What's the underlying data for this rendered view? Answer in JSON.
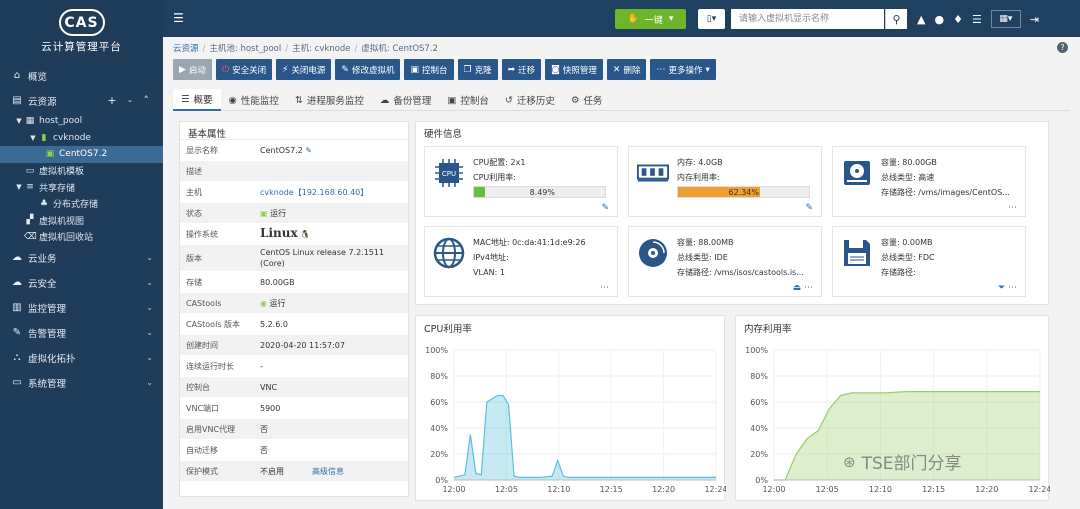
{
  "app": {
    "logo": "CAS",
    "title": "云计算管理平台"
  },
  "sidebar": {
    "items": [
      {
        "icon": "home-icon",
        "label": "概览"
      },
      {
        "icon": "cloud-resource-icon",
        "label": "云资源",
        "tools": "+ - ^"
      }
    ],
    "tree": [
      {
        "label": "host_pool",
        "toggle": "▾"
      },
      {
        "label": "cvknode",
        "toggle": "▾"
      },
      {
        "label": "CentOS7.2",
        "toggle": ""
      },
      {
        "label": "虚拟机模板",
        "toggle": ""
      },
      {
        "label": "共享存储",
        "toggle": "▾"
      },
      {
        "label": "分布式存储",
        "toggle": ""
      },
      {
        "label": "虚拟机视图",
        "toggle": ""
      },
      {
        "label": "虚拟机回收站",
        "toggle": ""
      }
    ],
    "bottom": [
      {
        "icon": "cloud-service-icon",
        "label": "云业务"
      },
      {
        "icon": "cloud-security-icon",
        "label": "云安全"
      },
      {
        "icon": "monitor-icon",
        "label": "监控管理"
      },
      {
        "icon": "alarm-icon",
        "label": "告警管理"
      },
      {
        "icon": "topology-icon",
        "label": "虚拟化拓扑"
      },
      {
        "icon": "system-icon",
        "label": "系统管理"
      }
    ]
  },
  "topbar": {
    "onekey": "一键",
    "search_placeholder": "请输入虚拟机显示名称"
  },
  "breadcrumb": [
    "云资源",
    "主机池: host_pool",
    "主机: cvknode",
    "虚拟机: CentOS7.2"
  ],
  "actions": [
    {
      "label": "启动",
      "icon": "start-icon",
      "disabled": true
    },
    {
      "label": "安全关闭",
      "icon": "power-icon",
      "disabled": false
    },
    {
      "label": "关闭电源",
      "icon": "plug-icon",
      "disabled": false
    },
    {
      "label": "修改虚拟机",
      "icon": "edit-icon",
      "disabled": false
    },
    {
      "label": "控制台",
      "icon": "console-icon",
      "disabled": false
    },
    {
      "label": "克隆",
      "icon": "clone-icon",
      "disabled": false
    },
    {
      "label": "迁移",
      "icon": "migrate-icon",
      "disabled": false
    },
    {
      "label": "快照管理",
      "icon": "camera-icon",
      "disabled": false
    },
    {
      "label": "删除",
      "icon": "delete-icon",
      "disabled": false
    },
    {
      "label": "更多操作",
      "icon": "more-icon",
      "disabled": false
    }
  ],
  "tabs": [
    "概要",
    "性能监控",
    "进程服务监控",
    "备份管理",
    "控制台",
    "迁移历史",
    "任务"
  ],
  "props": {
    "title": "基本属性",
    "rows": [
      {
        "label": "显示名称",
        "value": "CentOS7.2"
      },
      {
        "label": "描述",
        "value": ""
      },
      {
        "label": "主机",
        "value": "cvknode【192.168.60.40】"
      },
      {
        "label": "状态",
        "value": "运行"
      },
      {
        "label": "操作系统",
        "value": "Linux"
      },
      {
        "label": "版本",
        "value": "CentOS Linux release 7.2.1511 (Core)"
      },
      {
        "label": "存储",
        "value": "80.00GB"
      },
      {
        "label": "CAStools",
        "value": "运行"
      },
      {
        "label": "CAStools 版本",
        "value": "5.2.6.0"
      },
      {
        "label": "创建时间",
        "value": "2020-04-20 11:57:07"
      },
      {
        "label": "连续运行时长",
        "value": "-"
      },
      {
        "label": "控制台",
        "value": "VNC"
      },
      {
        "label": "VNC端口",
        "value": "5900"
      },
      {
        "label": "启用VNC代理",
        "value": "否"
      },
      {
        "label": "自动迁移",
        "value": "否"
      },
      {
        "label": "保护模式",
        "value": "不启用"
      }
    ],
    "advanced_link": "高级信息"
  },
  "hardware": {
    "title": "硬件信息",
    "cpu": {
      "config_label": "CPU配置:",
      "config": "2x1",
      "usage_label": "CPU利用率:",
      "usage_pct": 8.49,
      "usage_text": "8.49%",
      "icon_text": "CPU"
    },
    "memory": {
      "mem_label": "内存:",
      "mem": "4.0GB",
      "usage_label": "内存利用率:",
      "usage_pct": 62.34,
      "usage_text": "62.34%"
    },
    "disk": {
      "cap_label": "容量:",
      "cap": "80.00GB",
      "bus_label": "总线类型:",
      "bus": "高速",
      "path_label": "存储路径:",
      "path": "/vms/images/CentOS..."
    },
    "network": {
      "mac_label": "MAC地址:",
      "mac": "0c:da:41:1d:e9:26",
      "ipv4_label": "IPv4地址:",
      "ipv4": "",
      "vlan_label": "VLAN:",
      "vlan": "1"
    },
    "cdrom": {
      "cap_label": "容量:",
      "cap": "88.00MB",
      "bus_label": "总线类型:",
      "bus": "IDE",
      "path_label": "存储路径:",
      "path": "/vms/isos/castools.is..."
    },
    "floppy": {
      "cap_label": "容量:",
      "cap": "0.00MB",
      "bus_label": "总线类型:",
      "bus": "FDC",
      "path_label": "存储路径:",
      "path": ""
    }
  },
  "chart_data": [
    {
      "type": "area",
      "title": "CPU利用率",
      "color": "#5bc0de",
      "ylim": [
        0,
        100
      ],
      "yticks": [
        "100%",
        "80%",
        "60%",
        "40%",
        "20%",
        "0%"
      ],
      "xticks": [
        "12:00",
        "12:05",
        "12:10",
        "12:15",
        "12:20",
        "12:24"
      ],
      "x": [
        0,
        1,
        1.5,
        2,
        2.5,
        3,
        4,
        4.5,
        5,
        5.5,
        6,
        6.5,
        7,
        8,
        9,
        9.5,
        10,
        10.5,
        11,
        12,
        15,
        18,
        21,
        24
      ],
      "y": [
        2,
        4,
        35,
        5,
        4,
        60,
        65,
        65,
        58,
        3,
        2,
        2,
        2,
        2,
        3,
        15,
        3,
        2,
        2,
        2,
        2,
        2,
        2,
        2
      ],
      "grid": true
    },
    {
      "type": "area",
      "title": "内存利用率",
      "color": "#9acd6a",
      "ylim": [
        0,
        100
      ],
      "yticks": [
        "100%",
        "80%",
        "60%",
        "40%",
        "20%",
        "0%"
      ],
      "xticks": [
        "12:00",
        "12:05",
        "12:10",
        "12:15",
        "12:20",
        "12:24"
      ],
      "x": [
        0,
        1,
        2,
        3,
        4,
        5,
        6,
        7,
        8,
        10,
        12,
        24
      ],
      "y": [
        0,
        0,
        20,
        32,
        38,
        55,
        65,
        67,
        67,
        67,
        68,
        68
      ],
      "grid": true
    }
  ],
  "watermark": "TSE部门分享"
}
